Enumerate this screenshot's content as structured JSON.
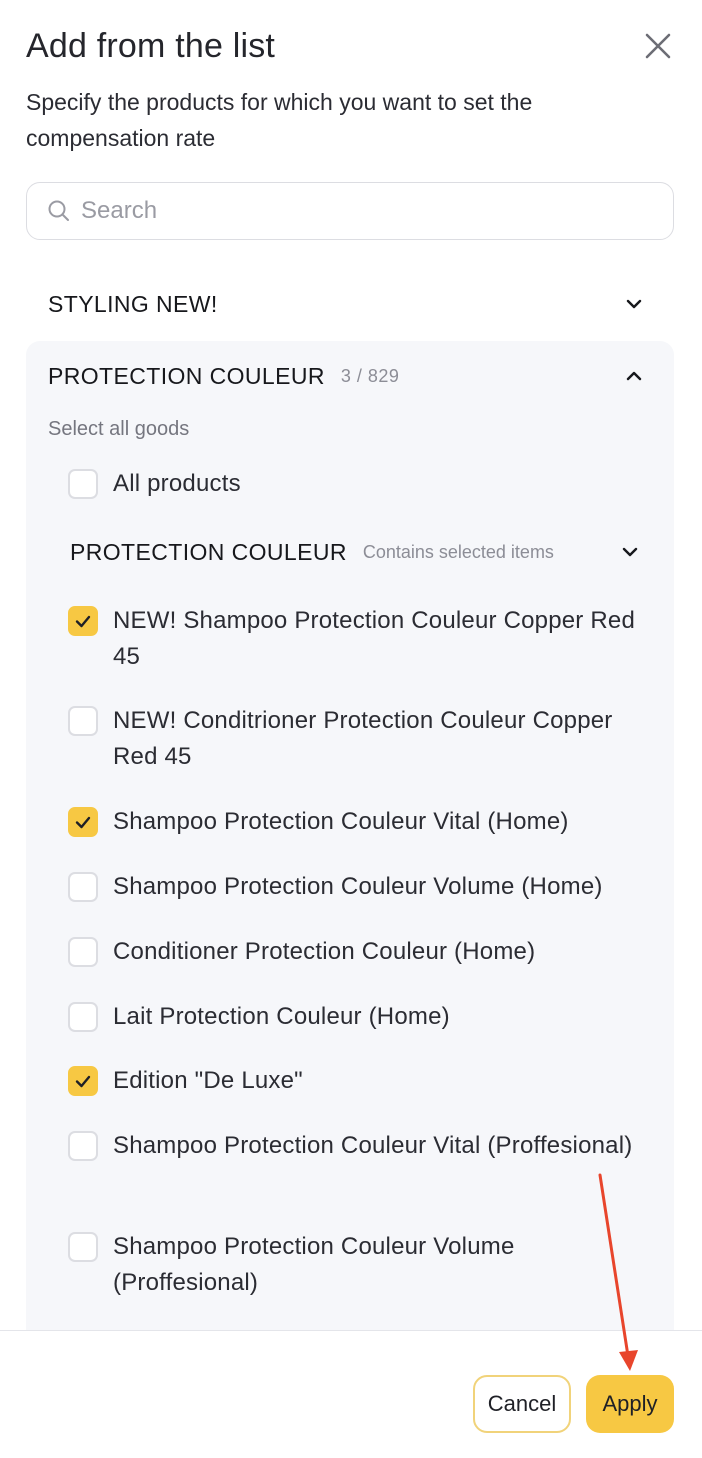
{
  "dialog": {
    "title": "Add from the list",
    "subtitle": "Specify the products for which you want to set the compensation rate"
  },
  "search": {
    "placeholder": "Search",
    "value": ""
  },
  "groups": [
    {
      "title": "STYLING NEW!",
      "expanded": false
    },
    {
      "title": "PROTECTION COULEUR",
      "count": "3 / 829",
      "expanded": true,
      "select_all_label": "Select all goods",
      "all_products_label": "All products",
      "all_products_checked": false,
      "subgroup": {
        "title": "PROTECTION COULEUR",
        "note": "Contains selected items",
        "items": [
          {
            "label": "NEW! Shampoo Protection Couleur Copper Red 45",
            "checked": true
          },
          {
            "label": "NEW! Conditrioner Protection Couleur Copper Red 45",
            "checked": false
          },
          {
            "label": "Shampoo Protection Couleur Vital (Home)",
            "checked": true
          },
          {
            "label": "Shampoo Protection Couleur Volume (Home)",
            "checked": false
          },
          {
            "label": "Conditioner Protection Couleur (Home)",
            "checked": false
          },
          {
            "label": "Lait Protection Couleur (Home)",
            "checked": false
          },
          {
            "label": "Edition \"De Luxe\"",
            "checked": true
          },
          {
            "label": "Shampoo Protection Couleur Vital (Proffesional)",
            "checked": false
          },
          {
            "label": "Shampoo Protection Couleur Volume (Proffesional)",
            "checked": false
          }
        ]
      }
    }
  ],
  "footer": {
    "cancel_label": "Cancel",
    "apply_label": "Apply"
  },
  "colors": {
    "accent": "#f7c843",
    "panel_bg": "#f6f7fa",
    "annotation_arrow": "#e8452c"
  },
  "icons": [
    "close-icon",
    "search-icon",
    "chevron-down-icon",
    "chevron-up-icon",
    "check-icon"
  ]
}
